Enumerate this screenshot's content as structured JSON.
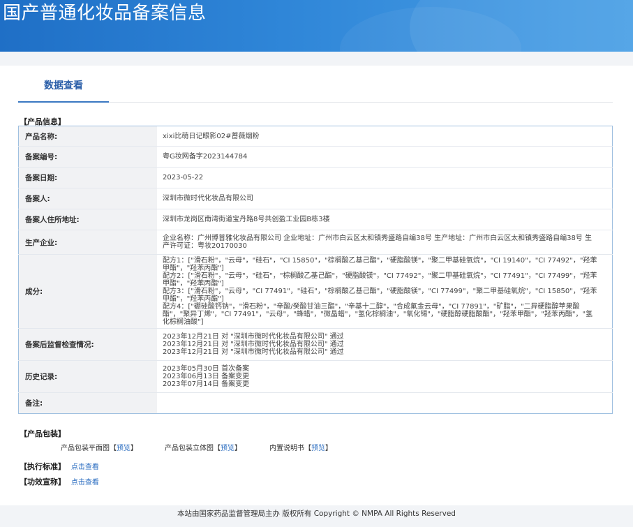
{
  "header": {
    "title": "国产普通化妆品备案信息"
  },
  "tabs": {
    "data_view": "数据查看"
  },
  "product_info": {
    "section_title": "【产品信息】",
    "rows": {
      "product_name": {
        "label": "产品名称:",
        "value": "xixi比萌日记眼影02#蔷薇烟粉"
      },
      "record_no": {
        "label": "备案编号:",
        "value": "粤G妆网备字2023144784"
      },
      "record_date": {
        "label": "备案日期:",
        "value": "2023-05-22"
      },
      "registrant": {
        "label": "备案人:",
        "value": "深圳市微时代化妆品有限公司"
      },
      "registrant_address": {
        "label": "备案人住所地址:",
        "value": "深圳市龙岗区南湾街道宝丹路8号共创盈工业园B栋3楼"
      },
      "manufacturer": {
        "label": "生产企业:",
        "lines": [
          "企业名称：广州博普雅化妆品有限公司 企业地址：广州市白云区太和镇秀盛路自编38号 生产地址：广州市白云区太和镇秀盛路自编38号 生",
          "产许可证：粤妆20170030"
        ]
      },
      "ingredients": {
        "label": "成分:",
        "lines": [
          "配方1：[\"滑石粉\"，\"云母\"，\"硅石\"，\"CI 15850\"，\"棕榈酸乙基己酯\"，\"硬脂酸镁\"，\"聚二甲基硅氧烷\"，\"CI 19140\"，\"CI 77492\"，\"羟苯",
          "甲酯\"，\"羟苯丙酯\"]",
          "配方2：[\"滑石粉\"，\"云母\"，\"硅石\"，\"棕榈酸乙基己酯\"，\"硬脂酸镁\"，\"CI 77492\"，\"聚二甲基硅氧烷\"，\"CI 77491\"，\"CI 77499\"，\"羟苯",
          "甲酯\"，\"羟苯丙酯\"]",
          "配方3：[\"滑石粉\"，\"云母\"，\"CI 77491\"，\"硅石\"，\"棕榈酸乙基己酯\"，\"硬脂酸镁\"，\"CI 77499\"，\"聚二甲基硅氧烷\"，\"CI 15850\"，\"羟苯",
          "甲酯\"，\"羟苯丙酯\"]",
          "配方4：[\"硼硅酸钙钠\"，\"滑石粉\"，\"辛酸/癸酸甘油三酯\"，\"辛基十二醇\"，\"合成氟金云母\"，\"CI 77891\"，\"矿脂\"，\"二异硬脂醇苹果酸",
          "酯\"，\"聚异丁烯\"，\"CI 77491\"，\"云母\"，\"蜂蜡\"，\"微晶蜡\"，\"氢化棕榈油\"，\"氧化锡\"，\"硬脂醇硬脂酸酯\"，\"羟苯甲酯\"，\"羟苯丙酯\"，\"氢",
          "化棕榈油酸\"]"
        ]
      },
      "inspection": {
        "label": "备案后监督检查情况:",
        "lines": [
          "2023年12月21日 对 \"深圳市微时代化妆品有限公司\" 通过",
          "2023年12月21日 对 \"深圳市微时代化妆品有限公司\" 通过",
          "2023年12月21日 对 \"深圳市微时代化妆品有限公司\" 通过"
        ]
      },
      "history": {
        "label": "历史记录:",
        "lines": [
          "2023年05月30日 首次备案",
          "2023年06月13日 备案变更",
          "2023年07月14日 备案变更"
        ]
      },
      "remarks": {
        "label": "备注:",
        "value": ""
      }
    }
  },
  "packaging": {
    "section_title": "【产品包装】",
    "items": [
      {
        "label": "产品包装平面图",
        "link": "预览"
      },
      {
        "label": "产品包装立体图",
        "link": "预览"
      },
      {
        "label": "内置说明书",
        "link": "预览"
      }
    ]
  },
  "standard": {
    "title": "【执行标准】",
    "link": "点击查看"
  },
  "efficacy": {
    "title": "【功效宣称】",
    "link": "点击查看"
  },
  "footer": {
    "text": "本站由国家药品监督管理局主办 版权所有 Copyright © NMPA All Rights Reserved"
  },
  "colors": {
    "banner": "#2f86d8",
    "link": "#2a6cc0",
    "table_border": "#9fc0e0"
  }
}
